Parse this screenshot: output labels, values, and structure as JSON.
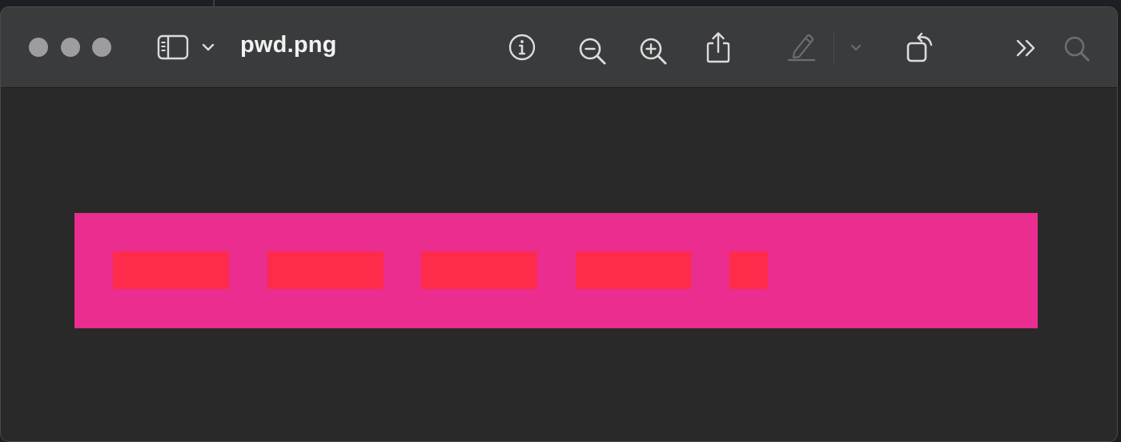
{
  "window": {
    "title": "pwd.png"
  },
  "toolbar": {
    "buttons": [
      {
        "name": "sidebar-toggle",
        "icon": "sidebar-icon"
      },
      {
        "name": "sidebar-menu",
        "icon": "chevron-down-icon"
      },
      {
        "name": "info",
        "icon": "info-icon"
      },
      {
        "name": "zoom-out",
        "icon": "zoom-out-icon"
      },
      {
        "name": "zoom-in",
        "icon": "zoom-in-icon"
      },
      {
        "name": "share",
        "icon": "share-icon"
      },
      {
        "name": "markup",
        "icon": "pen-icon",
        "disabled": true
      },
      {
        "name": "markup-menu",
        "icon": "chevron-down-icon",
        "disabled": true
      },
      {
        "name": "rotate",
        "icon": "rotate-icon"
      },
      {
        "name": "more",
        "icon": "double-chevron-right-icon"
      },
      {
        "name": "search",
        "icon": "search-icon",
        "disabled": true
      }
    ]
  },
  "image": {
    "background_color": "#ea2d8f",
    "mask_color": "#ff2b4a",
    "masked_blocks": 5
  },
  "colors": {
    "titlebar": "#3a3b3d",
    "content": "#292929",
    "traffic_light": "#9d9d9f",
    "icon": "#dcdcdc",
    "icon_disabled": "#6e6e70"
  }
}
